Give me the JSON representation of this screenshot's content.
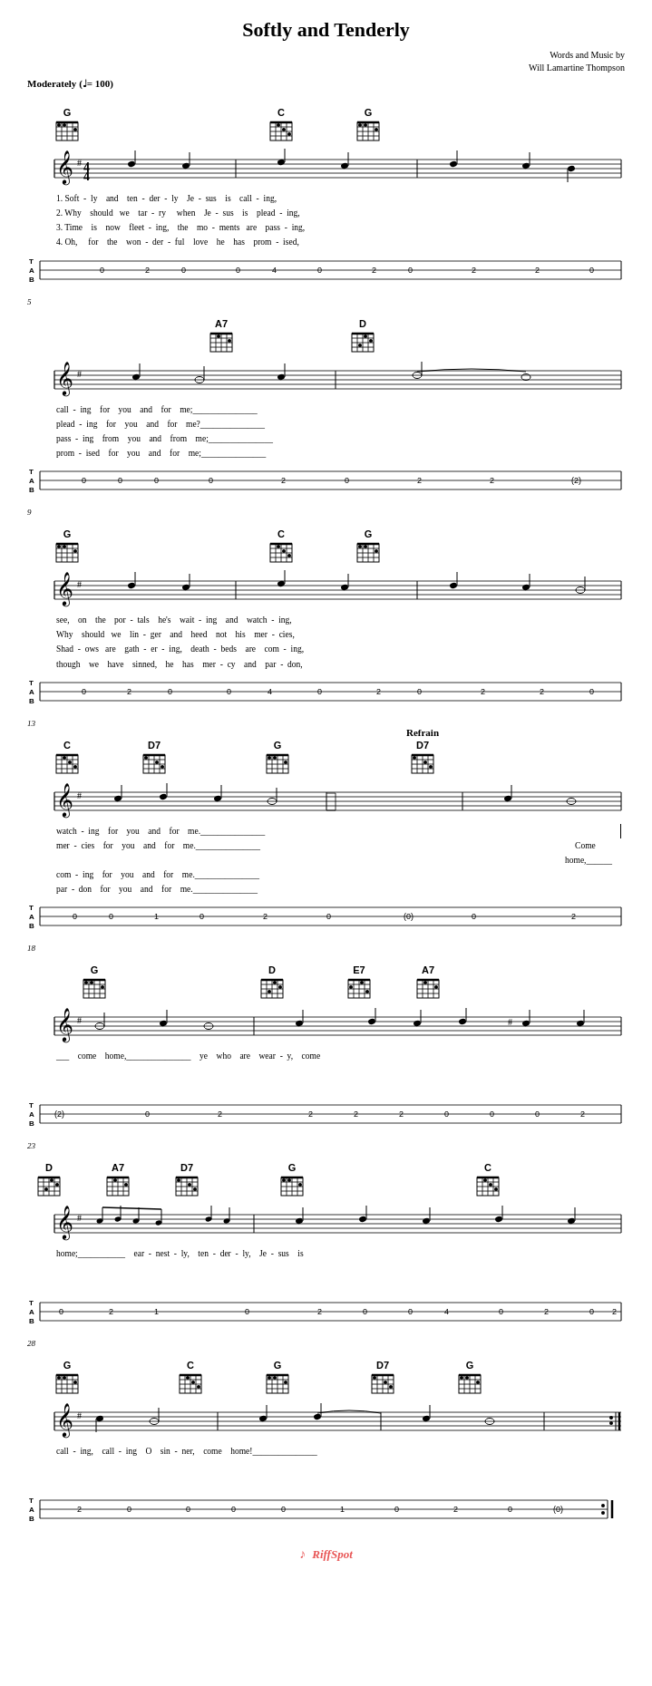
{
  "title": "Softly and Tenderly",
  "composer": {
    "line1": "Words and Music by",
    "line2": "Will Lamartine Thompson"
  },
  "tempo": {
    "label": "Moderately",
    "bpm": "♩= 100"
  },
  "systems": [
    {
      "number": "",
      "chords": [
        {
          "name": "G",
          "position": "left"
        },
        {
          "name": "C",
          "position": "mid"
        },
        {
          "name": "G",
          "position": "right"
        }
      ],
      "lyrics": [
        "1. Soft  -  ly    and    ten  -  der  -  ly    Je  -  sus    is    call  -  ing,",
        "2. Why    should  we    tar  -  ry    when    Je  -  sus    is    plead  -  ing,",
        "3. Time    is    now    fleet  -  ing,    the    mo  -  ments  are    pass  -  ing,",
        "4. Oh,    for    the    won  -  der  -  ful    love    he    has    prom  -  ised,"
      ],
      "tab": "0   2  0      0  4     0    2  0         2      2    0"
    },
    {
      "number": "5",
      "chords": [
        {
          "name": "A7",
          "position": "mid"
        },
        {
          "name": "D",
          "position": "right"
        }
      ],
      "lyrics": [
        "call  -  ing    for    you    and    for    me;_______________",
        "plead  -  ing    for    you    and    for    me?_______________",
        "pass  -  ing    from    you    and    from    me;_______________",
        "prom  -  ised    for    you    and    for    me;_______________"
      ],
      "tab": "0   0   0      0       2   0      2        2       (2)"
    },
    {
      "number": "9",
      "chords": [
        {
          "name": "G",
          "position": "left"
        },
        {
          "name": "C",
          "position": "mid"
        },
        {
          "name": "G",
          "position": "right"
        }
      ],
      "lyrics": [
        "see,    on    the    por  -  tals    he's    wait  -  ing    and    watch  -  ing,",
        "Why    should  we    lin  -  ger    and    heed    not    his    mer  -  cies,",
        "Shad  -  ows  are    gath  -  er  -  ing,    death  -  beds    are    com  -  ing,",
        "though    we    have    sinned,    he    has    mer  -  cy    and    par  -  don,"
      ],
      "tab": "0   2  0      0  4     0    2  0         2      2    0"
    },
    {
      "number": "13",
      "chords": [
        {
          "name": "C",
          "position": "left"
        },
        {
          "name": "D7",
          "position": "mid-left"
        },
        {
          "name": "G",
          "position": "mid"
        },
        {
          "name": "D7",
          "position": "right"
        }
      ],
      "refrain": true,
      "lyrics": [
        "watch  -  ing    for    you    and    for    me._______________",
        "mer  -  cies    for    you    and    for    me._______________",
        "com  -  ing    for    you    and    for    me._______________",
        "par  -  don    for    you    and    for    me._______________"
      ],
      "extra_lyric": "Come    home,______",
      "tab": "0  0     1   0        2    0         (0)      0        2"
    },
    {
      "number": "18",
      "chords": [
        {
          "name": "G",
          "position": "left"
        },
        {
          "name": "D",
          "position": "mid"
        },
        {
          "name": "E7",
          "position": "mid-right"
        },
        {
          "name": "A7",
          "position": "right"
        }
      ],
      "lyrics": [
        "___    come    home,_______________    ye    who    are    wear  -  y,    come"
      ],
      "tab": "(2)     0      2         2   2  2      0  0  0   2"
    },
    {
      "number": "23",
      "chords": [
        {
          "name": "D",
          "position": "left"
        },
        {
          "name": "A7",
          "position": "mid-left"
        },
        {
          "name": "D7",
          "position": "mid"
        },
        {
          "name": "G",
          "position": "mid-right"
        },
        {
          "name": "C",
          "position": "right"
        }
      ],
      "lyrics": [
        "home;___________    ear  -  nest  -  ly,    ten  -  der  -  ly,    Je  -  sus    is"
      ],
      "tab": "0    2   1        0        2  0   0  4     0   2   0        2"
    },
    {
      "number": "28",
      "chords": [
        {
          "name": "G",
          "position": "left"
        },
        {
          "name": "C",
          "position": "mid-left"
        },
        {
          "name": "G",
          "position": "mid"
        },
        {
          "name": "D7",
          "position": "mid-right"
        },
        {
          "name": "G",
          "position": "right"
        }
      ],
      "lyrics": [
        "call  -  ing,    call  -  ing    O    sin  -  ner,    come    home!_______________"
      ],
      "tab": "2  0      0  0  0       1   0         2   0          (0)"
    }
  ]
}
